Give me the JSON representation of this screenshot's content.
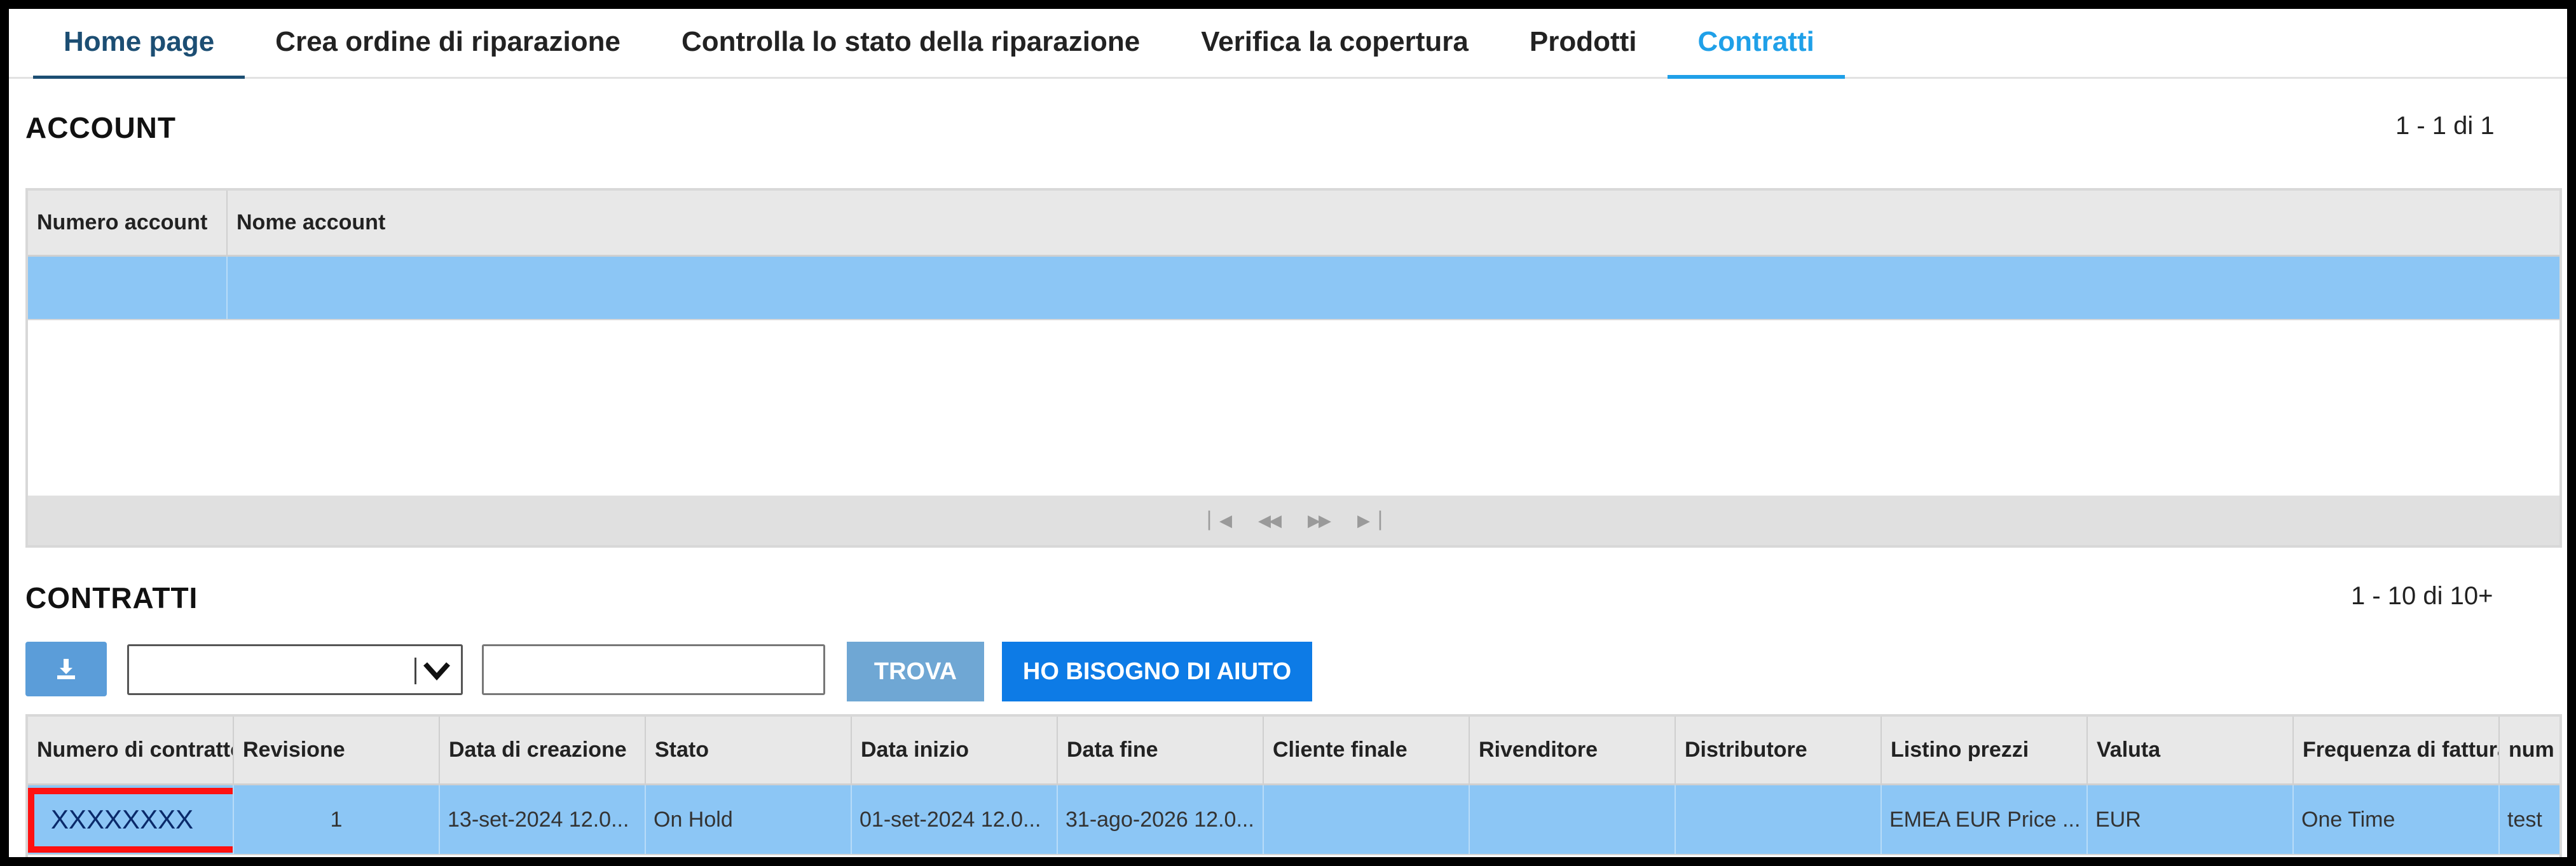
{
  "nav": {
    "tabs": [
      {
        "label": "Home page"
      },
      {
        "label": "Crea ordine di riparazione"
      },
      {
        "label": "Controlla lo stato della riparazione"
      },
      {
        "label": "Verifica la copertura"
      },
      {
        "label": "Prodotti"
      },
      {
        "label": "Contratti"
      }
    ],
    "active_tab": "Contratti"
  },
  "account": {
    "title": "ACCOUNT",
    "pager": "1 - 1 di 1",
    "columns": [
      "Numero account",
      "Nome account"
    ],
    "rows": [
      [
        "",
        ""
      ]
    ],
    "pager_icons": [
      "first-page-icon",
      "prev-page-icon",
      "next-page-icon",
      "last-page-icon"
    ]
  },
  "contracts": {
    "title": "CONTRATTI",
    "pager": "1 - 10 di 10+",
    "download_icon": "download-icon",
    "filter_select_value": "",
    "search_value": "",
    "find_button": "TROVA",
    "help_button": "HO BISOGNO DI AIUTO",
    "columns": [
      "Numero di contratto",
      "Revisione",
      "Data di creazione",
      "Stato",
      "Data inizio",
      "Data fine",
      "Cliente finale",
      "Rivenditore",
      "Distributore",
      "Listino prezzi",
      "Valuta",
      "Frequenza di fatturazione",
      "num"
    ],
    "rows": [
      {
        "contract_number": "XXXXXXXX",
        "revision": "1",
        "created": "13-set-2024 12.0...",
        "status": "On Hold",
        "start": "01-set-2024 12.0...",
        "end": "31-ago-2026 12.0...",
        "end_customer": "",
        "reseller": "",
        "distributor": "",
        "price_list": "EMEA EUR Price ...",
        "currency": "EUR",
        "billing_frequency": "One Time",
        "num": "test"
      }
    ],
    "highlight_color": "#ff1111"
  },
  "colors": {
    "accent": "#1fa0e8",
    "home_tab": "#1c4e73",
    "selected_row": "#8cc6f5",
    "primary_button": "#0d7be6",
    "secondary_button": "#6fa7d4"
  }
}
